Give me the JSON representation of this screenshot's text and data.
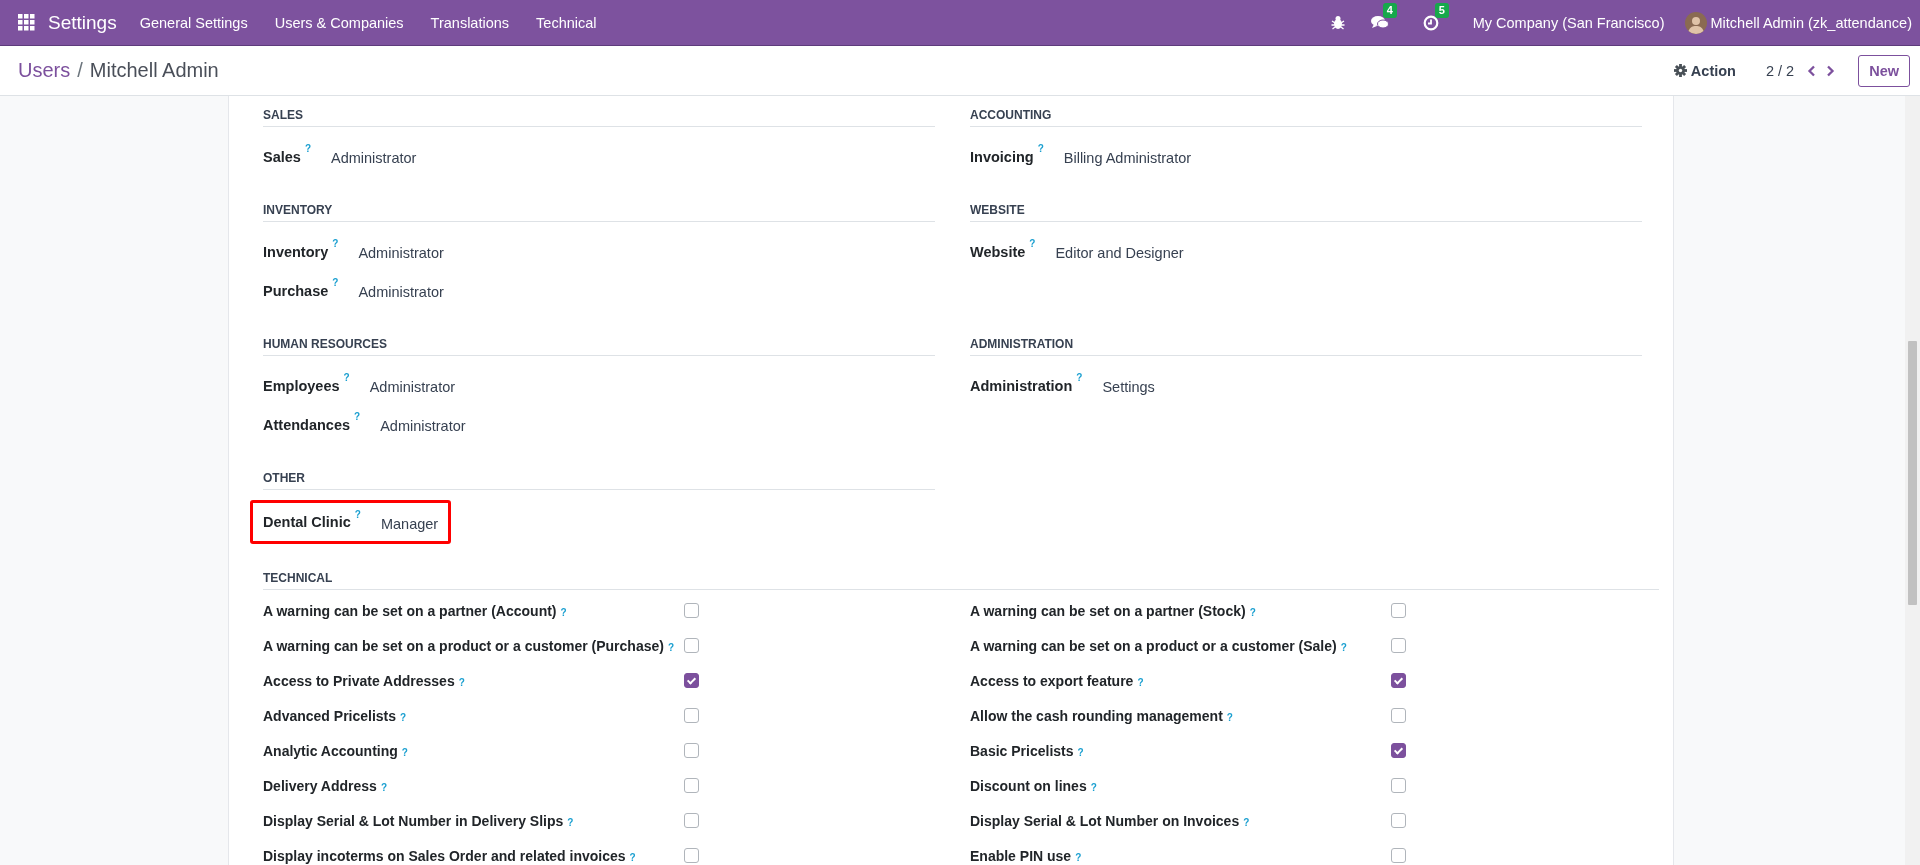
{
  "navbar": {
    "brand": "Settings",
    "menu": [
      "General Settings",
      "Users & Companies",
      "Translations",
      "Technical"
    ],
    "chat_count": "4",
    "activity_count": "5",
    "company": "My Company (San Francisco)",
    "user": "Mitchell Admin (zk_attendance)"
  },
  "breadcrumb": {
    "parent": "Users",
    "separator": "/",
    "current": "Mitchell Admin"
  },
  "control_panel": {
    "action": "Action",
    "pager": "2 / 2",
    "new_button": "New"
  },
  "sections": [
    {
      "title": "SALES",
      "fields": [
        {
          "label": "Sales",
          "help": "?",
          "value": "Administrator",
          "highlighted": false
        }
      ]
    },
    {
      "title": "ACCOUNTING",
      "fields": [
        {
          "label": "Invoicing",
          "help": "?",
          "value": "Billing Administrator",
          "highlighted": false
        }
      ]
    },
    {
      "title": "INVENTORY",
      "fields": [
        {
          "label": "Inventory",
          "help": "?",
          "value": "Administrator",
          "highlighted": false
        },
        {
          "label": "Purchase",
          "help": "?",
          "value": "Administrator",
          "highlighted": false
        }
      ]
    },
    {
      "title": "WEBSITE",
      "fields": [
        {
          "label": "Website",
          "help": "?",
          "value": "Editor and Designer",
          "highlighted": false
        }
      ]
    },
    {
      "title": "HUMAN RESOURCES",
      "fields": [
        {
          "label": "Employees",
          "help": "?",
          "value": "Administrator",
          "highlighted": false
        },
        {
          "label": "Attendances",
          "help": "?",
          "value": "Administrator",
          "highlighted": false
        }
      ]
    },
    {
      "title": "ADMINISTRATION",
      "fields": [
        {
          "label": "Administration",
          "help": "?",
          "value": "Settings",
          "highlighted": false
        }
      ]
    },
    {
      "title": "OTHER",
      "fields": [
        {
          "label": "Dental Clinic",
          "help": "?",
          "value": "Manager",
          "highlighted": true
        }
      ]
    }
  ],
  "technical": {
    "title": "TECHNICAL",
    "options": [
      {
        "label": "A warning can be set on a partner (Account)",
        "help": "?",
        "checked": false
      },
      {
        "label": "A warning can be set on a partner (Stock)",
        "help": "?",
        "checked": false
      },
      {
        "label": "A warning can be set on a product or a customer (Purchase)",
        "help": "?",
        "checked": false
      },
      {
        "label": "A warning can be set on a product or a customer (Sale)",
        "help": "?",
        "checked": false
      },
      {
        "label": "Access to Private Addresses",
        "help": "?",
        "checked": true
      },
      {
        "label": "Access to export feature",
        "help": "?",
        "checked": true
      },
      {
        "label": "Advanced Pricelists",
        "help": "?",
        "checked": false
      },
      {
        "label": "Allow the cash rounding management",
        "help": "?",
        "checked": false
      },
      {
        "label": "Analytic Accounting",
        "help": "?",
        "checked": false
      },
      {
        "label": "Basic Pricelists",
        "help": "?",
        "checked": true
      },
      {
        "label": "Delivery Address",
        "help": "?",
        "checked": false
      },
      {
        "label": "Discount on lines",
        "help": "?",
        "checked": false
      },
      {
        "label": "Display Serial & Lot Number in Delivery Slips",
        "help": "?",
        "checked": false
      },
      {
        "label": "Display Serial & Lot Number on Invoices",
        "help": "?",
        "checked": false
      },
      {
        "label": "Display incoterms on Sales Order and related invoices",
        "help": "?",
        "checked": false
      },
      {
        "label": "Enable PIN use",
        "help": "?",
        "checked": false
      }
    ]
  }
}
